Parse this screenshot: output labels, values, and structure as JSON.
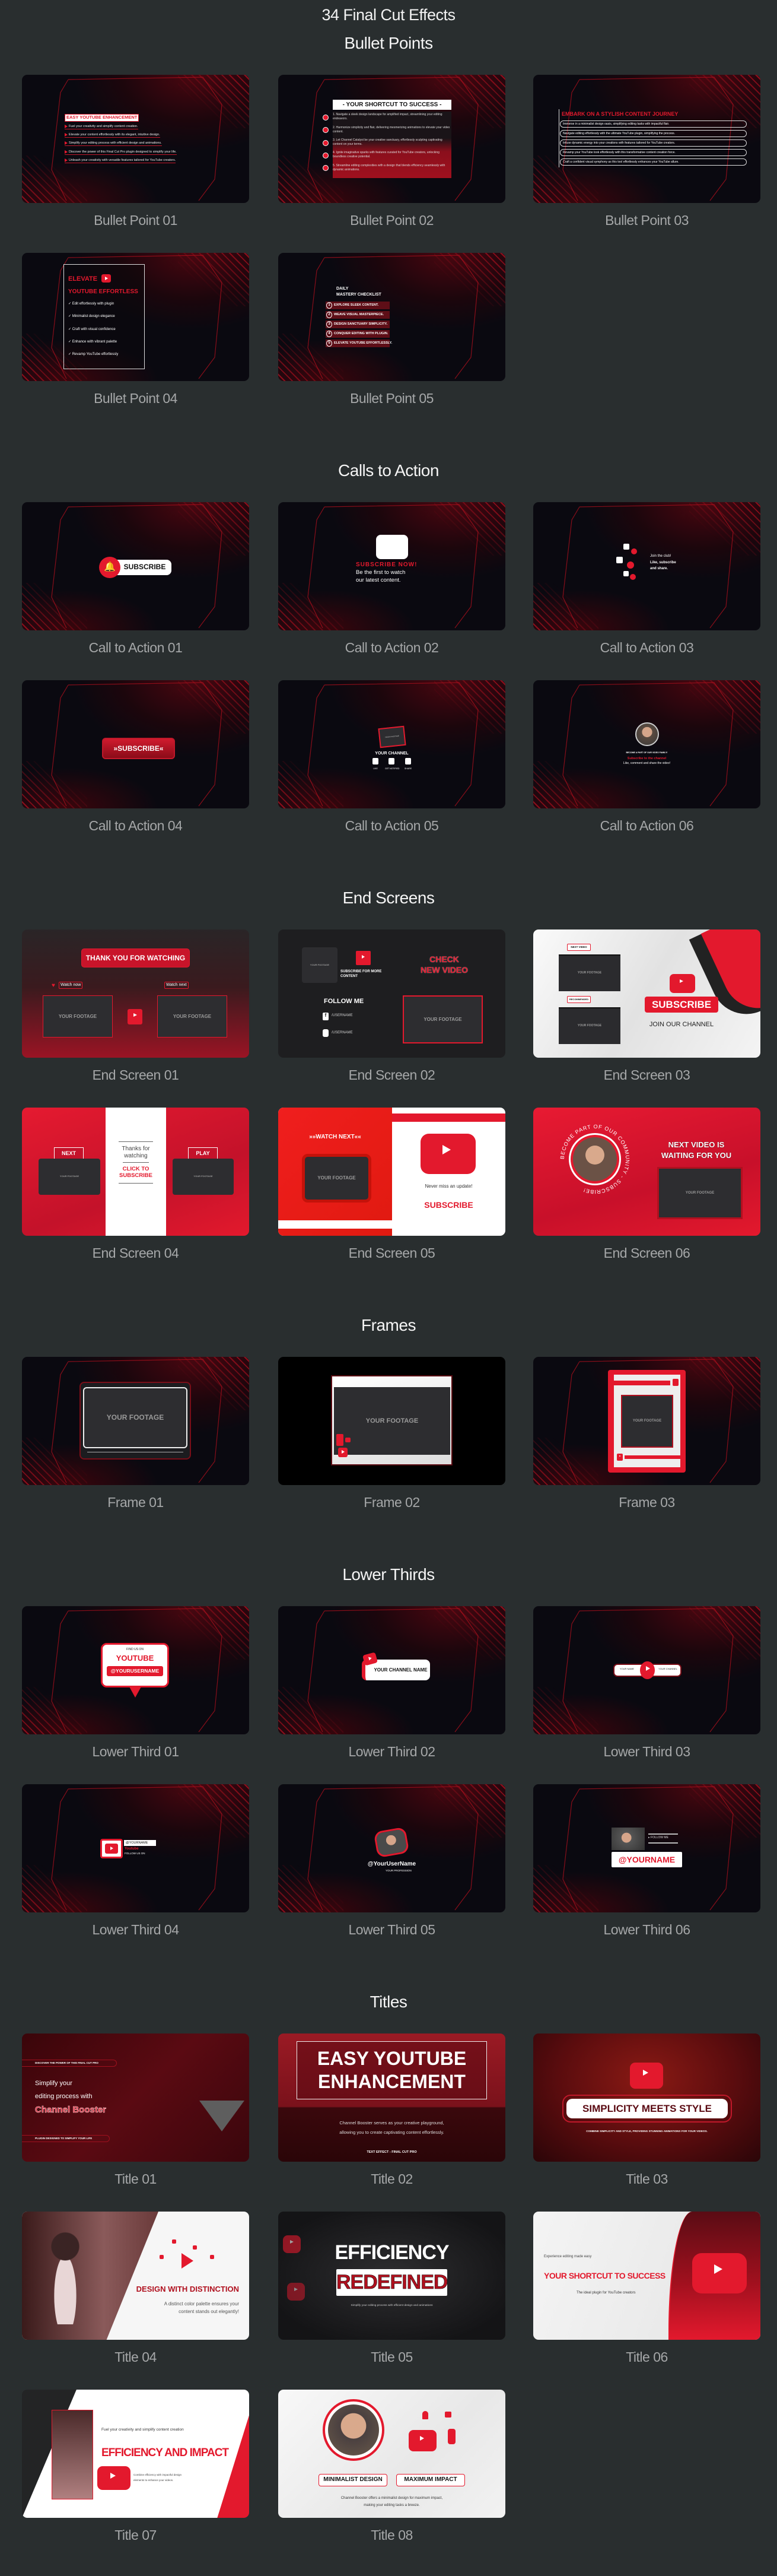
{
  "page": {
    "title": "34 Final Cut Effects"
  },
  "colors": {
    "background": "#292e2f",
    "accent": "#e3192d",
    "label": "#a5a7a8"
  },
  "sections": [
    {
      "heading": "Bullet Points",
      "items": [
        {
          "label": "Bullet Point 01",
          "preview": {
            "heading": "EASY YOUTUBE ENHANCEMENT",
            "items": [
              "Fuel your creativity and simplify content creation.",
              "Elevate your content effortlessly with its elegant, intuitive design.",
              "Simplify your editing process with efficient design and animations.",
              "Discover the power of this Final Cut Pro plugin designed to simplify your life.",
              "Unleash your creativity with versatile features tailored for YouTube creators."
            ]
          }
        },
        {
          "label": "Bullet Point 02",
          "preview": {
            "heading": "- YOUR SHORTCUT TO SUCCESS -",
            "items": [
              "1. Navigate a sleek design landscape for amplified impact, streamlining your editing endeavors.",
              "2. Harmonize simplicity and flair, delivering mesmerizing animations to elevate your video content.",
              "3. Let Channel Catalyst be your creative sanctuary, effortlessly sculpting captivating content on your terms.",
              "4. Ignite imaginative sparks with features curated for YouTube creators, unlocking boundless creative potential.",
              "5. Streamline editing complexities with a design that blends efficiency seamlessly with dynamic animations."
            ]
          }
        },
        {
          "label": "Bullet Point 03",
          "preview": {
            "heading": "EMBARK ON A STYLISH CONTENT JOURNEY",
            "items": [
              "Immerse in a minimalist design oasis, simplifying editing tasks with impactful flair.",
              "Navigate editing effortlessly with the ultimate YouTube plugin, simplifying the process.",
              "Infuse dynamic energy into your creations with features tailored for YouTube creators.",
              "Revamp your YouTube look effortlessly with this transformative content creation force.",
              "Craft a confident visual symphony as this tool effortlessly enhances your YouTube allure."
            ]
          }
        },
        {
          "label": "Bullet Point 04",
          "preview": {
            "heading_line1": "ELEVATE",
            "heading_line2": "YOUTUBE EFFORTLESS",
            "items": [
              "Edit effortlessly with plugin",
              "Minimalist design elegance",
              "Craft with visual confidence",
              "Enhance with vibrant palette",
              "Revamp YouTube effortlessly"
            ]
          }
        },
        {
          "label": "Bullet Point 05",
          "preview": {
            "heading_line1": "DAILY",
            "heading_line2": "MASTERY CHECKLIST",
            "numbers": [
              "1",
              "2",
              "3",
              "4",
              "5"
            ],
            "items": [
              "EXPLORE SLEEK CONTENT.",
              "WEAVE VISUAL MASTERPIECE.",
              "DESIGN SANCTUARY SIMPLICITY.",
              "CONQUER EDITING WITH PLUGIN.",
              "ELEVATE YOUTUBE EFFORTLESSLY."
            ]
          }
        }
      ]
    },
    {
      "heading": "Calls to Action",
      "items": [
        {
          "label": "Call to Action 01",
          "preview": {
            "button": "SUBSCRIBE"
          }
        },
        {
          "label": "Call to Action 02",
          "preview": {
            "heading": "SUBSCRIBE NOW!",
            "line1": "Be the first to watch",
            "line2": "our latest content."
          }
        },
        {
          "label": "Call to Action 03",
          "preview": {
            "line1": "Join the club!",
            "line2": "Like, subscribe",
            "line3": "and share."
          }
        },
        {
          "label": "Call to Action 04",
          "preview": {
            "button": "»SUBSCRIBE«"
          }
        },
        {
          "label": "Call to Action 05",
          "preview": {
            "footage": "YOUR FOOTAGE",
            "channel": "YOUR CHANNEL",
            "actions": [
              "LIKE",
              "GET NOTIFIED",
              "SHARE"
            ]
          }
        },
        {
          "label": "Call to Action 06",
          "preview": {
            "line1": "BECOME A PART OF OUR VIDEO FAMILY!",
            "line2": "Subscribe to the channel",
            "line3": "Like, comment and share the video!"
          }
        }
      ]
    },
    {
      "heading": "End Screens",
      "items": [
        {
          "label": "End Screen 01",
          "preview": {
            "heading": "THANK YOU FOR WATCHING",
            "watch_now": "Watch now",
            "watch_next": "Watch next",
            "footage": "YOUR FOOTAGE"
          }
        },
        {
          "label": "End Screen 02",
          "preview": {
            "footage": "YOUR FOOTAGE",
            "subscribe": "SUBSCRIBE FOR MORE CONTENT",
            "check_line1": "CHECK",
            "check_line2": "NEW VIDEO",
            "follow": "FOLLOW ME",
            "username": "/USERNAME"
          }
        },
        {
          "label": "End Screen 03",
          "preview": {
            "next_video": "NEXT VIDEO",
            "recommended": "RECOMMENDED",
            "footage": "YOUR FOOTAGE",
            "subscribe": "SUBSCRIBE",
            "join": "JOIN OUR CHANNEL"
          }
        },
        {
          "label": "End Screen 04",
          "preview": {
            "next": "NEXT",
            "play": "PLAY",
            "footage": "YOUR FOOTAGE",
            "thanks": "Thanks for watching",
            "click": "CLICK TO SUBSCRIBE"
          }
        },
        {
          "label": "End Screen 05",
          "preview": {
            "watch_next": "»»WATCH NEXT««",
            "footage": "YOUR FOOTAGE",
            "never_miss": "Never miss an update!",
            "subscribe": "SUBSCRIBE"
          }
        },
        {
          "label": "End Screen 06",
          "preview": {
            "ring_text": "BECOME PART OF OUR COMMUNITY - SUBSCRIBE!",
            "heading_line1": "NEXT VIDEO IS",
            "heading_line2": "WAITING FOR YOU",
            "footage": "YOUR FOOTAGE"
          }
        }
      ]
    },
    {
      "heading": "Frames",
      "items": [
        {
          "label": "Frame 01",
          "preview": {
            "footage": "YOUR FOOTAGE"
          }
        },
        {
          "label": "Frame 02",
          "preview": {
            "footage": "YOUR FOOTAGE"
          }
        },
        {
          "label": "Frame 03",
          "preview": {
            "footage": "YOUR FOOTAGE"
          }
        }
      ]
    },
    {
      "heading": "Lower Thirds",
      "items": [
        {
          "label": "Lower Third 01",
          "preview": {
            "find": "FIND US ON",
            "platform": "YOUTUBE",
            "username": "@YOURUSERNAME"
          }
        },
        {
          "label": "Lower Third 02",
          "preview": {
            "channel": "YOUR CHANNEL NAME"
          }
        },
        {
          "label": "Lower Third 03",
          "preview": {
            "name": "YOUR NAME",
            "channel": "YOUR CHANNEL"
          }
        },
        {
          "label": "Lower Third 04",
          "preview": {
            "username": "@YOURNAME",
            "platform": "Youtube",
            "follow": "FOLLOW US ON"
          }
        },
        {
          "label": "Lower Third 05",
          "preview": {
            "username": "@YourUserName",
            "profession": "YOUR PROFESSION"
          }
        },
        {
          "label": "Lower Third 06",
          "preview": {
            "follow": "FOLLOW ME",
            "username": "@YOURNAME"
          }
        }
      ]
    },
    {
      "heading": "Titles",
      "items": [
        {
          "label": "Title 01",
          "preview": {
            "top_tag": "DISCOVER THE POWER OF THIS FINAL CUT PRO",
            "line1": "Simplify your",
            "line2": "editing process with",
            "highlight": "Channel Booster",
            "bottom_tag": "PLUGIN DESIGNED TO SIMPLIFY YOUR LIFE"
          }
        },
        {
          "label": "Title 02",
          "preview": {
            "line1": "EASY YOUTUBE",
            "line2": "ENHANCEMENT",
            "body1": "Channel Booster serves as your creative playground,",
            "body2": "allowing you to create captivating content effortlessly.",
            "footer": "TEXT EFFECT - FINAL CUT PRO"
          }
        },
        {
          "label": "Title 03",
          "preview": {
            "heading": "SIMPLICITY MEETS STYLE",
            "sub": "COMBINE SIMPLICITY AND STYLE, PROVIDING STUNNING ANIMATIONS FOR YOUR VIDEOS."
          }
        },
        {
          "label": "Title 04",
          "preview": {
            "heading": "DESIGN WITH DISTINCTION",
            "body1": "A distinct color palette ensures your",
            "body2": "content stands out elegantly!"
          }
        },
        {
          "label": "Title 05",
          "preview": {
            "line1": "EFFICIENCY",
            "line2": "REDEFINED",
            "sub": "Simplify your editing process with efficient design and animations"
          }
        },
        {
          "label": "Title 06",
          "preview": {
            "kicker": "Experience editing made easy",
            "heading": "YOUR SHORTCUT TO SUCCESS",
            "sub": "The ideal plugin for YouTube creators"
          }
        },
        {
          "label": "Title 07",
          "preview": {
            "kicker": "Fuel your creativity and simplify content creation",
            "heading": "EFFICIENCY AND IMPACT",
            "body1": "Combine efficiency with impactful design",
            "body2": "elements to enhance your videos."
          }
        },
        {
          "label": "Title 08",
          "preview": {
            "tag1": "MINIMALIST DESIGN",
            "tag2": "MAXIMUM IMPACT",
            "body1": "Channel Booster offers a minimalist design for maximum impact,",
            "body2": "making your editing tasks a breeze."
          }
        }
      ]
    }
  ]
}
